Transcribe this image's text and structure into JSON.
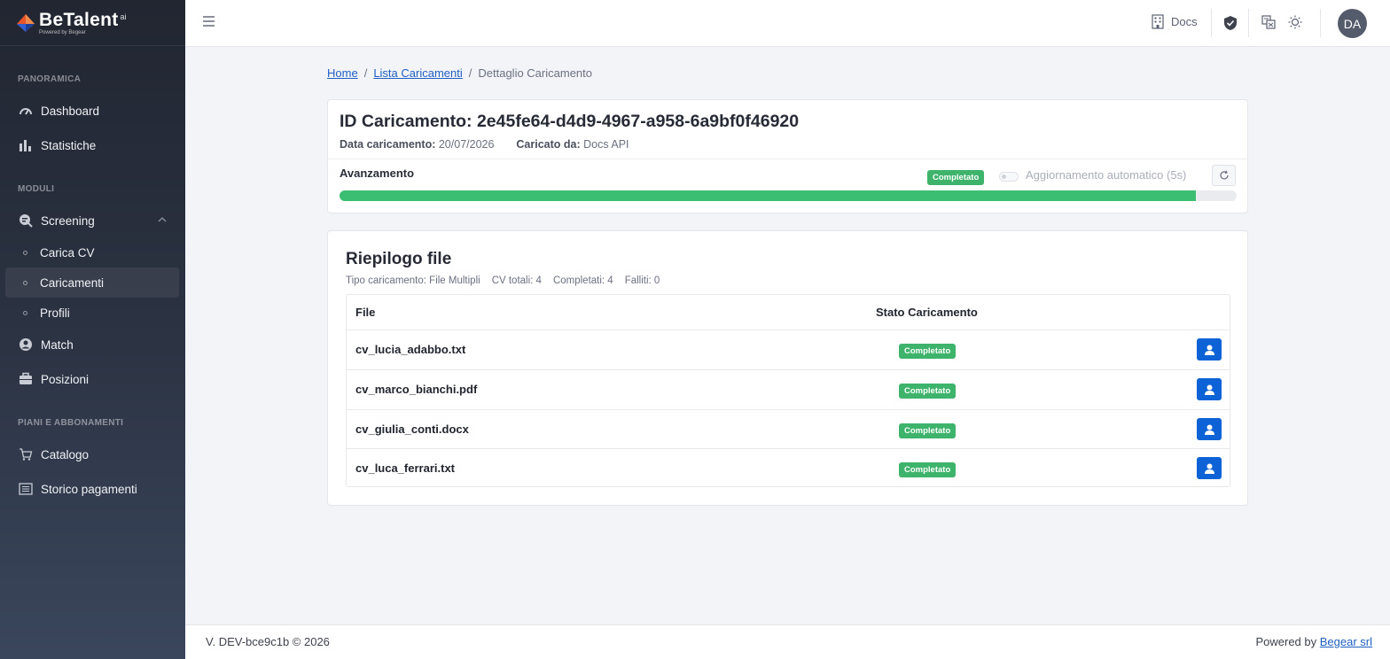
{
  "brand": {
    "name": "BeTalent",
    "sup": "ai",
    "sub": "Powered by Begear"
  },
  "sidebar": {
    "sections": [
      "PANORAMICA",
      "MODULI",
      "PIANI E ABBONAMENTI"
    ],
    "items": [
      {
        "label": "Dashboard",
        "icon": "speedometer-icon"
      },
      {
        "label": "Statistiche",
        "icon": "bar-chart-icon"
      },
      {
        "label": "Screening",
        "icon": "screening-icon"
      },
      {
        "label": "Carica CV"
      },
      {
        "label": "Caricamenti"
      },
      {
        "label": "Profili"
      },
      {
        "label": "Match",
        "icon": "user-circle-icon"
      },
      {
        "label": "Posizioni",
        "icon": "briefcase-icon"
      },
      {
        "label": "Catalogo",
        "icon": "cart-icon"
      },
      {
        "label": "Storico pagamenti",
        "icon": "list-icon"
      }
    ]
  },
  "header": {
    "docs_label": "Docs",
    "avatar_initials": "DA"
  },
  "breadcrumb": {
    "home": "Home",
    "list": "Lista Caricamenti",
    "current": "Dettaglio Caricamento",
    "sep": "/"
  },
  "upload": {
    "title": "ID Caricamento: 2e45fe64-d4d9-4967-a958-6a9bf0f46920",
    "date_label": "Data caricamento:",
    "date_value": "20/07/2026",
    "by_label": "Caricato da:",
    "by_value": "Docs API",
    "progress_label": "Avanzamento",
    "status": "Completato",
    "auto_refresh_label": "Aggiornamento automatico (5s)",
    "progress_fraction": 0.955,
    "colors": {
      "status_green": "#3db36b",
      "progress_green": "#3bbd72",
      "primary_blue": "#0d62d6"
    }
  },
  "summary": {
    "title": "Riepilogo file",
    "type": "Tipo caricamento: File Multipli",
    "total": "CV totali: 4",
    "completed": "Completati: 4",
    "failed": "Falliti: 0",
    "columns": {
      "file": "File",
      "status": "Stato Caricamento"
    },
    "rows": [
      {
        "file": "cv_lucia_adabbo.txt",
        "status": "Completato"
      },
      {
        "file": "cv_marco_bianchi.pdf",
        "status": "Completato"
      },
      {
        "file": "cv_giulia_conti.docx",
        "status": "Completato"
      },
      {
        "file": "cv_luca_ferrari.txt",
        "status": "Completato"
      }
    ]
  },
  "footer": {
    "version": "V. DEV-bce9c1b © 2026",
    "powered_label": "Powered by",
    "powered_link": "Begear srl"
  }
}
